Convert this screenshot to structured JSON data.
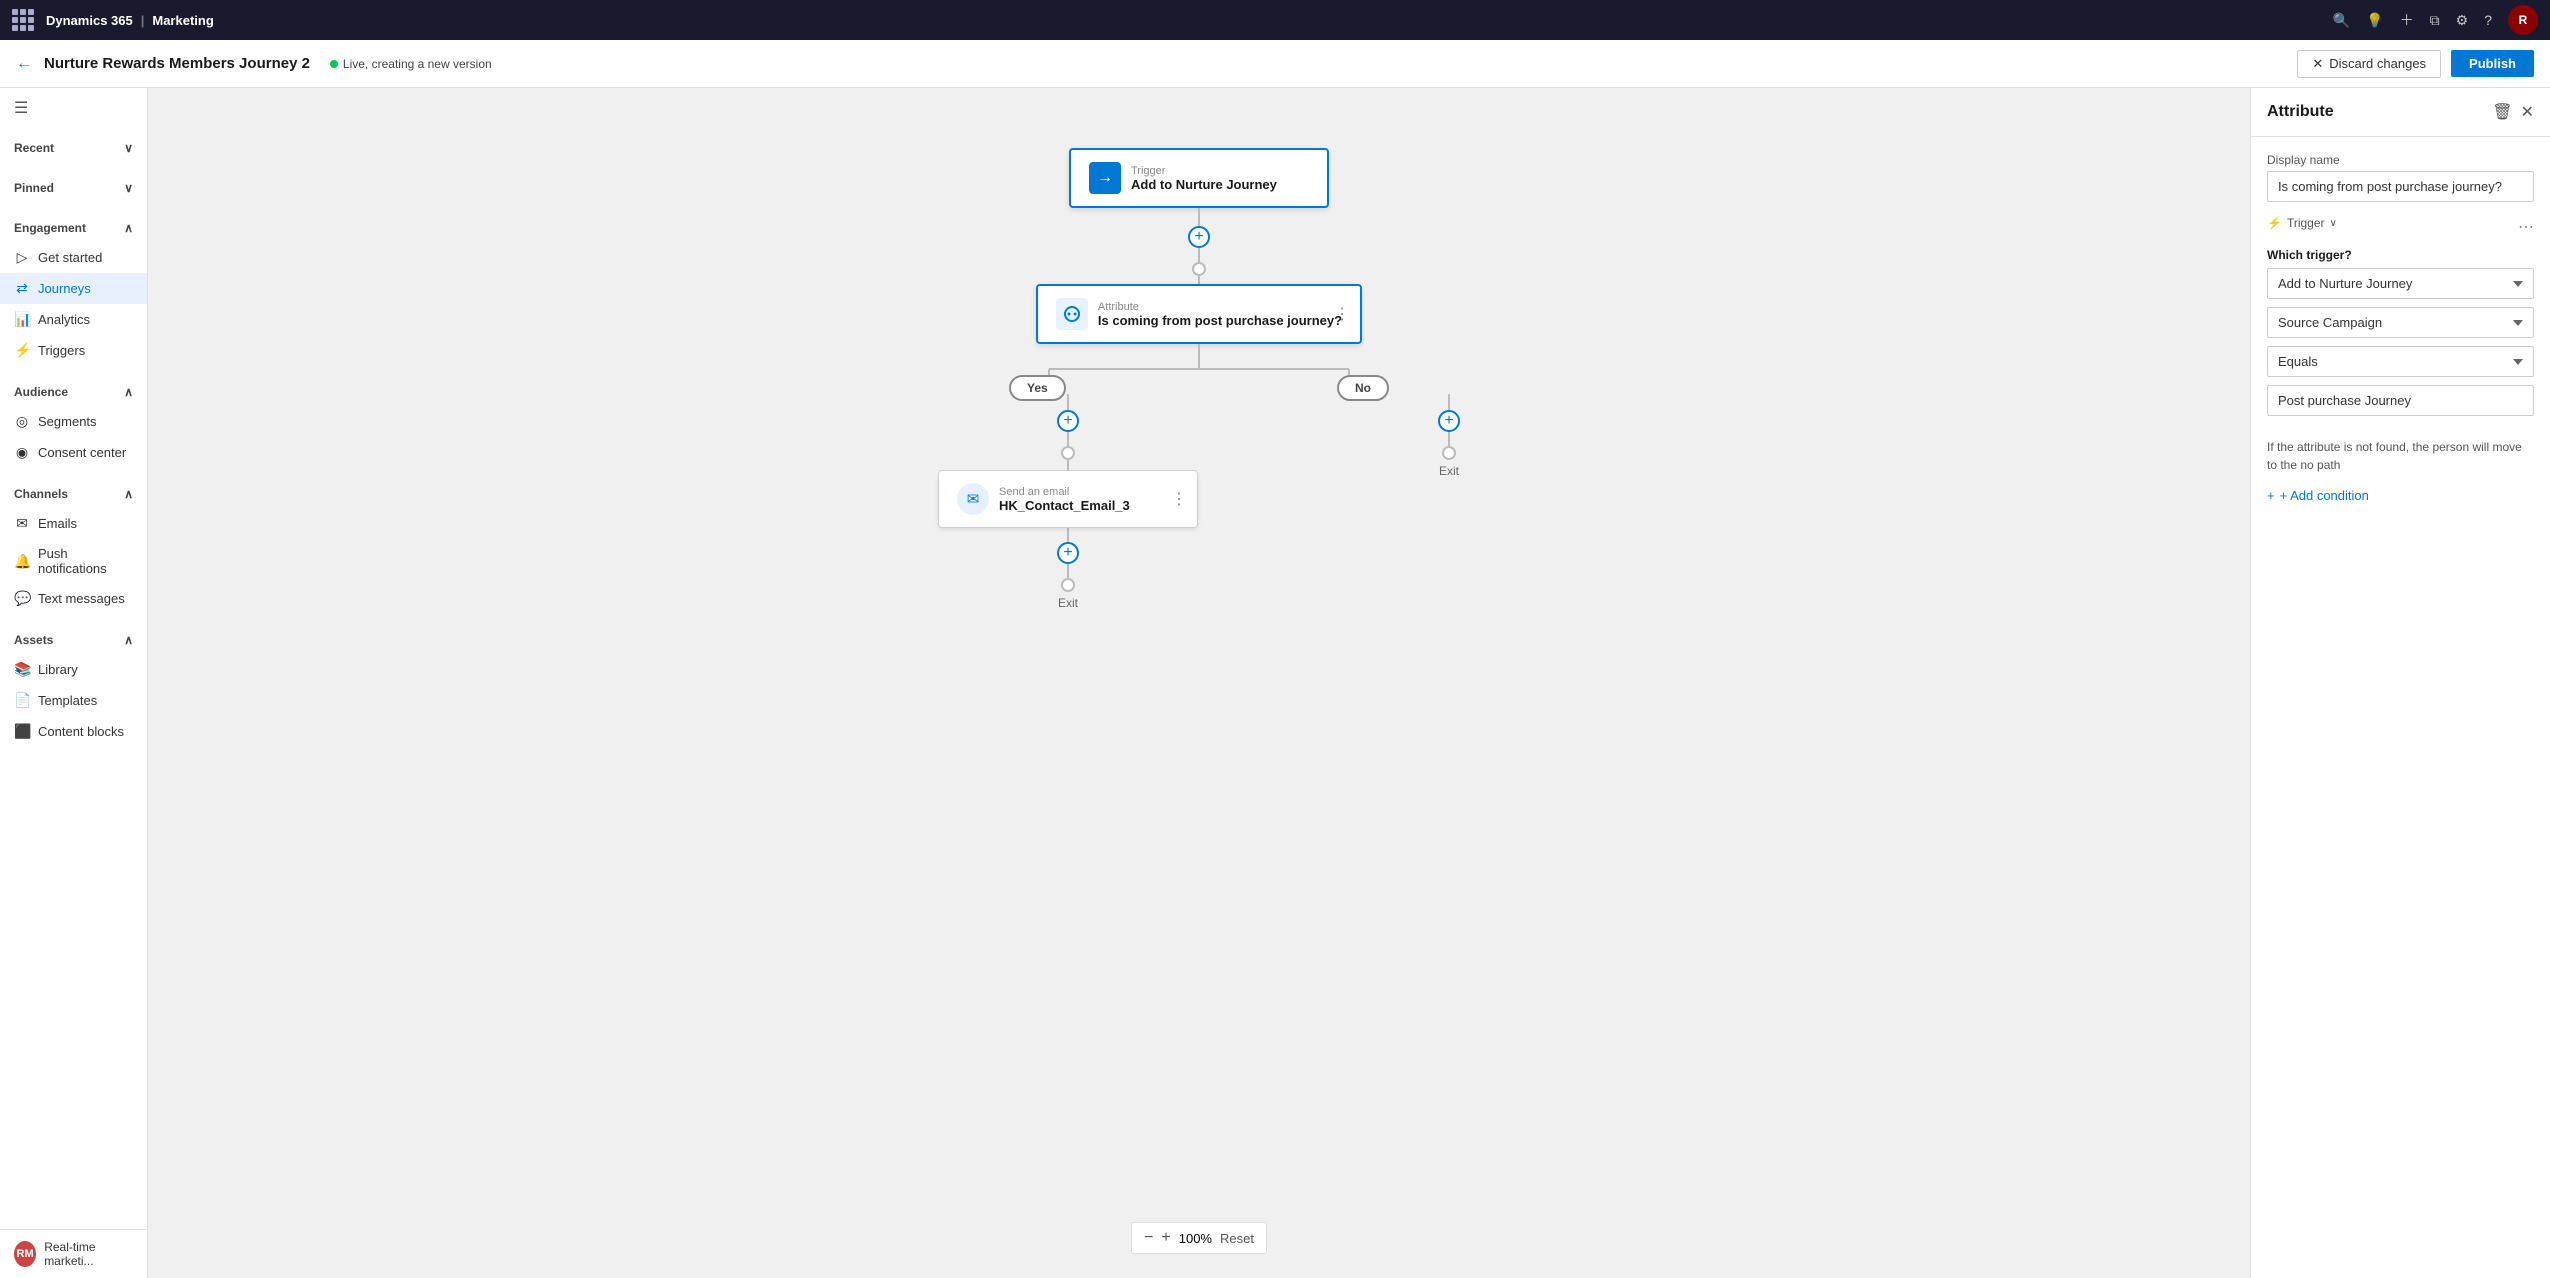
{
  "topbar": {
    "app_name": "Dynamics 365",
    "module": "Marketing",
    "icons": [
      "search",
      "lightbulb",
      "plus",
      "funnel",
      "settings",
      "question",
      "user"
    ]
  },
  "subheader": {
    "title": "Nurture Rewards Members Journey 2",
    "status": "Live, creating a new version",
    "discard_label": "Discard changes",
    "publish_label": "Publish"
  },
  "sidebar": {
    "hamburger": "☰",
    "recent_label": "Recent",
    "pinned_label": "Pinned",
    "engagement_label": "Engagement",
    "items_engagement": [
      {
        "icon": "▷",
        "label": "Get started"
      },
      {
        "icon": "⇄",
        "label": "Journeys",
        "active": true
      },
      {
        "icon": "📊",
        "label": "Analytics"
      },
      {
        "icon": "⚡",
        "label": "Triggers"
      }
    ],
    "audience_label": "Audience",
    "items_audience": [
      {
        "icon": "◎",
        "label": "Segments"
      },
      {
        "icon": "◉",
        "label": "Consent center"
      }
    ],
    "channels_label": "Channels",
    "items_channels": [
      {
        "icon": "✉",
        "label": "Emails"
      },
      {
        "icon": "🔔",
        "label": "Push notifications"
      },
      {
        "icon": "💬",
        "label": "Text messages"
      }
    ],
    "assets_label": "Assets",
    "items_assets": [
      {
        "icon": "📚",
        "label": "Library"
      },
      {
        "icon": "📄",
        "label": "Templates"
      },
      {
        "icon": "⬛",
        "label": "Content blocks"
      }
    ],
    "bottom_label": "Real-time marketi...",
    "avatar": "RM"
  },
  "canvas": {
    "trigger_node": {
      "label_small": "Trigger",
      "label_main": "Add to Nurture Journey"
    },
    "attribute_node": {
      "label_small": "Attribute",
      "label_main": "Is coming from post purchase journey?"
    },
    "yes_label": "Yes",
    "no_label": "No",
    "email_node": {
      "label_small": "Send an email",
      "label_main": "HK_Contact_Email_3"
    },
    "exit_label": "Exit",
    "exit_label2": "Exit",
    "zoom_value": "100%",
    "zoom_minus": "−",
    "zoom_plus": "+",
    "zoom_reset": "Reset"
  },
  "right_panel": {
    "title": "Attribute",
    "display_name_label": "Display name",
    "display_name_value": "Is coming from post purchase journey?",
    "trigger_badge": "Trigger",
    "which_trigger_label": "Which trigger?",
    "trigger_select": "Add to Nurture Journey",
    "source_campaign_select": "Source Campaign",
    "equals_select": "Equals",
    "value_input": "Post purchase Journey",
    "info_text": "If the attribute is not found, the person will move to the no path",
    "add_condition_label": "+ Add condition"
  }
}
